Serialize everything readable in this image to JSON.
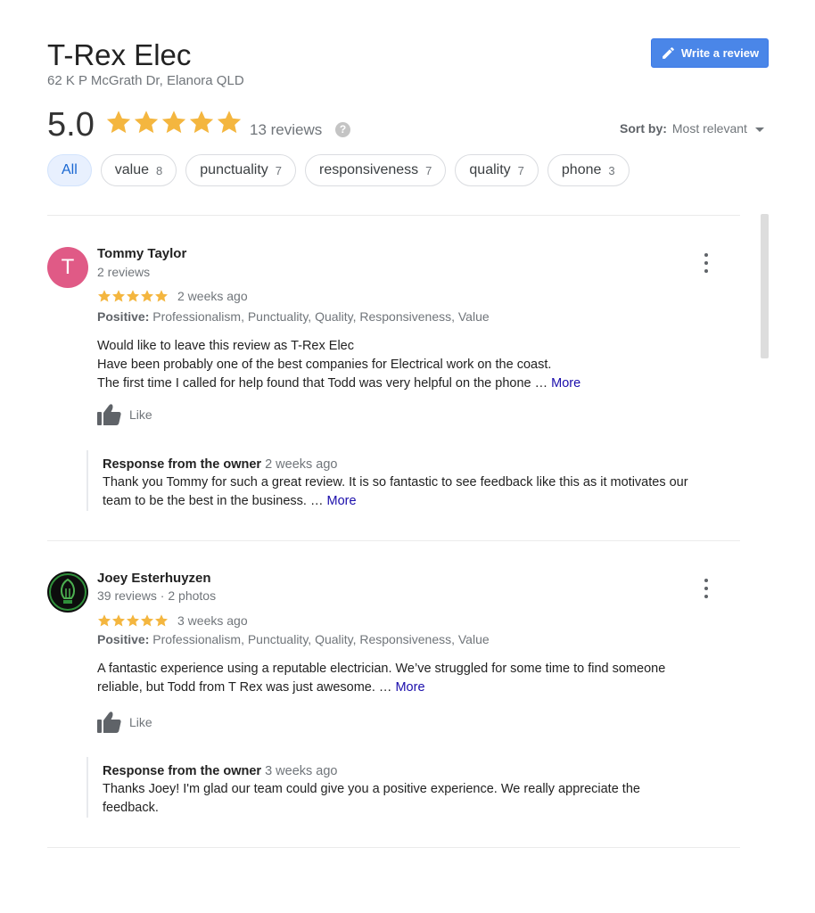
{
  "business": {
    "name": "T-Rex Elec",
    "address": "62 K P McGrath Dr, Elanora QLD",
    "write_review_label": "Write a review"
  },
  "summary": {
    "score": "5.0",
    "stars": 5,
    "reviews_label": "13 reviews",
    "help_glyph": "?"
  },
  "sort": {
    "label": "Sort by:",
    "value": "Most relevant"
  },
  "filters": [
    {
      "label": "All",
      "count": "",
      "active": true
    },
    {
      "label": "value",
      "count": "8",
      "active": false
    },
    {
      "label": "punctuality",
      "count": "7",
      "active": false
    },
    {
      "label": "responsiveness",
      "count": "7",
      "active": false
    },
    {
      "label": "quality",
      "count": "7",
      "active": false
    },
    {
      "label": "phone",
      "count": "3",
      "active": false
    }
  ],
  "reviews": [
    {
      "avatar_letter": "T",
      "avatar_color": "#e05a86",
      "name": "Tommy Taylor",
      "meta": "2 reviews",
      "stars": 5,
      "when": "2 weeks ago",
      "positive_label": "Positive:",
      "positive_text": "Professionalism, Punctuality, Quality, Responsiveness, Value",
      "lines": [
        "Would like to leave this review as T-Rex Elec",
        "Have been probably one of the best companies for Electrical work on the coast.",
        "The first time I called for help found that Todd was very helpful on the phone … "
      ],
      "more_label": "More",
      "like_label": "Like",
      "response": {
        "title": "Response from the owner",
        "when": "2 weeks ago",
        "lines": [
          "Thank you Tommy for such a great review. It is so fantastic to see feedback like this as it motivates our",
          "team to be the best in the business. … "
        ],
        "more_label": "More"
      }
    },
    {
      "avatar_letter": "",
      "name": "Joey Esterhuyzen",
      "meta": "39 reviews · 2 photos",
      "stars": 5,
      "when": "3 weeks ago",
      "positive_label": "Positive:",
      "positive_text": "Professionalism, Punctuality, Quality, Responsiveness, Value",
      "lines": [
        "A fantastic experience using a reputable electrician. We’ve struggled for some time to find someone",
        "reliable, but Todd from T Rex was just awesome. … "
      ],
      "more_label": "More",
      "like_label": "Like",
      "response": {
        "title": "Response from the owner",
        "when": "3 weeks ago",
        "lines": [
          "Thanks Joey! I'm glad our team could give you a positive experience. We really appreciate the",
          "feedback."
        ],
        "more_label": ""
      }
    }
  ],
  "colors": {
    "star": "#f4b63f",
    "link": "#1a0dab",
    "button": "#4a86e8",
    "chip_active_bg": "#e8f0fe"
  }
}
